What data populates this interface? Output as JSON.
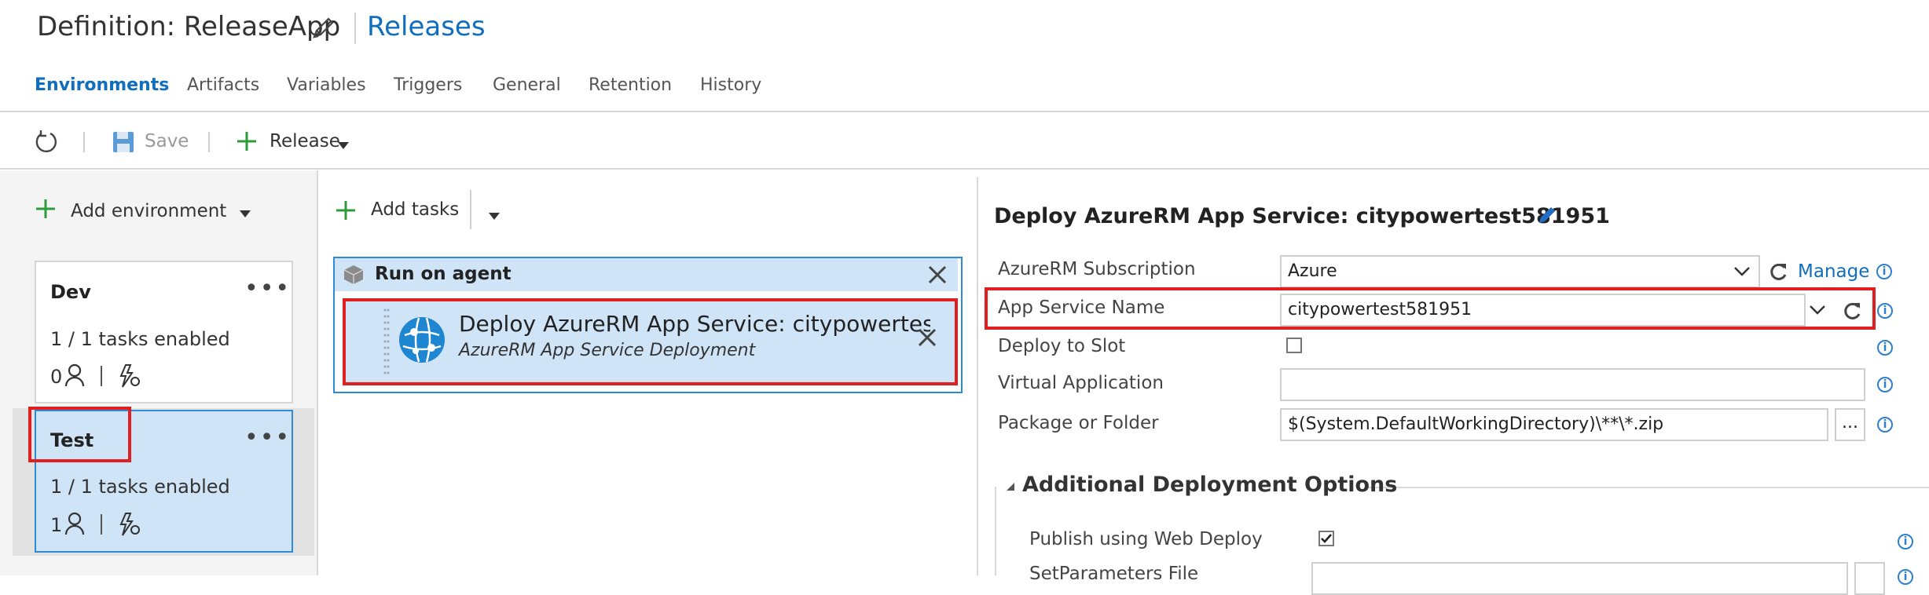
{
  "header": {
    "definition_title": "Definition: ReleaseApp",
    "releases_link": "Releases"
  },
  "tabs": [
    {
      "label": "Environments",
      "active": true
    },
    {
      "label": "Artifacts"
    },
    {
      "label": "Variables"
    },
    {
      "label": "Triggers"
    },
    {
      "label": "General"
    },
    {
      "label": "Retention"
    },
    {
      "label": "History"
    }
  ],
  "toolbar": {
    "refresh_icon": "refresh-icon",
    "save_label": "Save",
    "release_label": "Release"
  },
  "environments_panel": {
    "add_label": "Add environment",
    "environments": [
      {
        "name": "Dev",
        "tasks": "1 / 1 tasks enabled",
        "approvers": "0"
      },
      {
        "name": "Test",
        "tasks": "1 / 1 tasks enabled",
        "approvers": "1",
        "selected": true
      }
    ]
  },
  "tasks_panel": {
    "add_label": "Add tasks",
    "phase_title": "Run on agent",
    "task": {
      "title": "Deploy AzureRM App Service: citypowertest581951",
      "subtitle": "AzureRM App Service Deployment"
    }
  },
  "details_panel": {
    "title": "Deploy AzureRM App Service: citypowertest581951",
    "fields": {
      "subscription_label": "AzureRM Subscription",
      "subscription_value": "Azure",
      "manage_label": "Manage",
      "app_service_label": "App Service Name",
      "app_service_value": "citypowertest581951",
      "slot_label": "Deploy to Slot",
      "virtual_app_label": "Virtual Application",
      "virtual_app_value": "",
      "package_label": "Package or Folder",
      "package_value": "$(System.DefaultWorkingDirectory)\\**\\*.zip",
      "browse_label": "..."
    },
    "additional_section": {
      "title": "Additional Deployment Options",
      "publish_label": "Publish using Web Deploy",
      "publish_checked": true,
      "setparams_label": "SetParameters File"
    }
  },
  "colors": {
    "accent": "#106ebe",
    "selection_bg": "#cfe4f7",
    "highlight_red": "#e02020",
    "add_green": "#2e9b3a"
  }
}
